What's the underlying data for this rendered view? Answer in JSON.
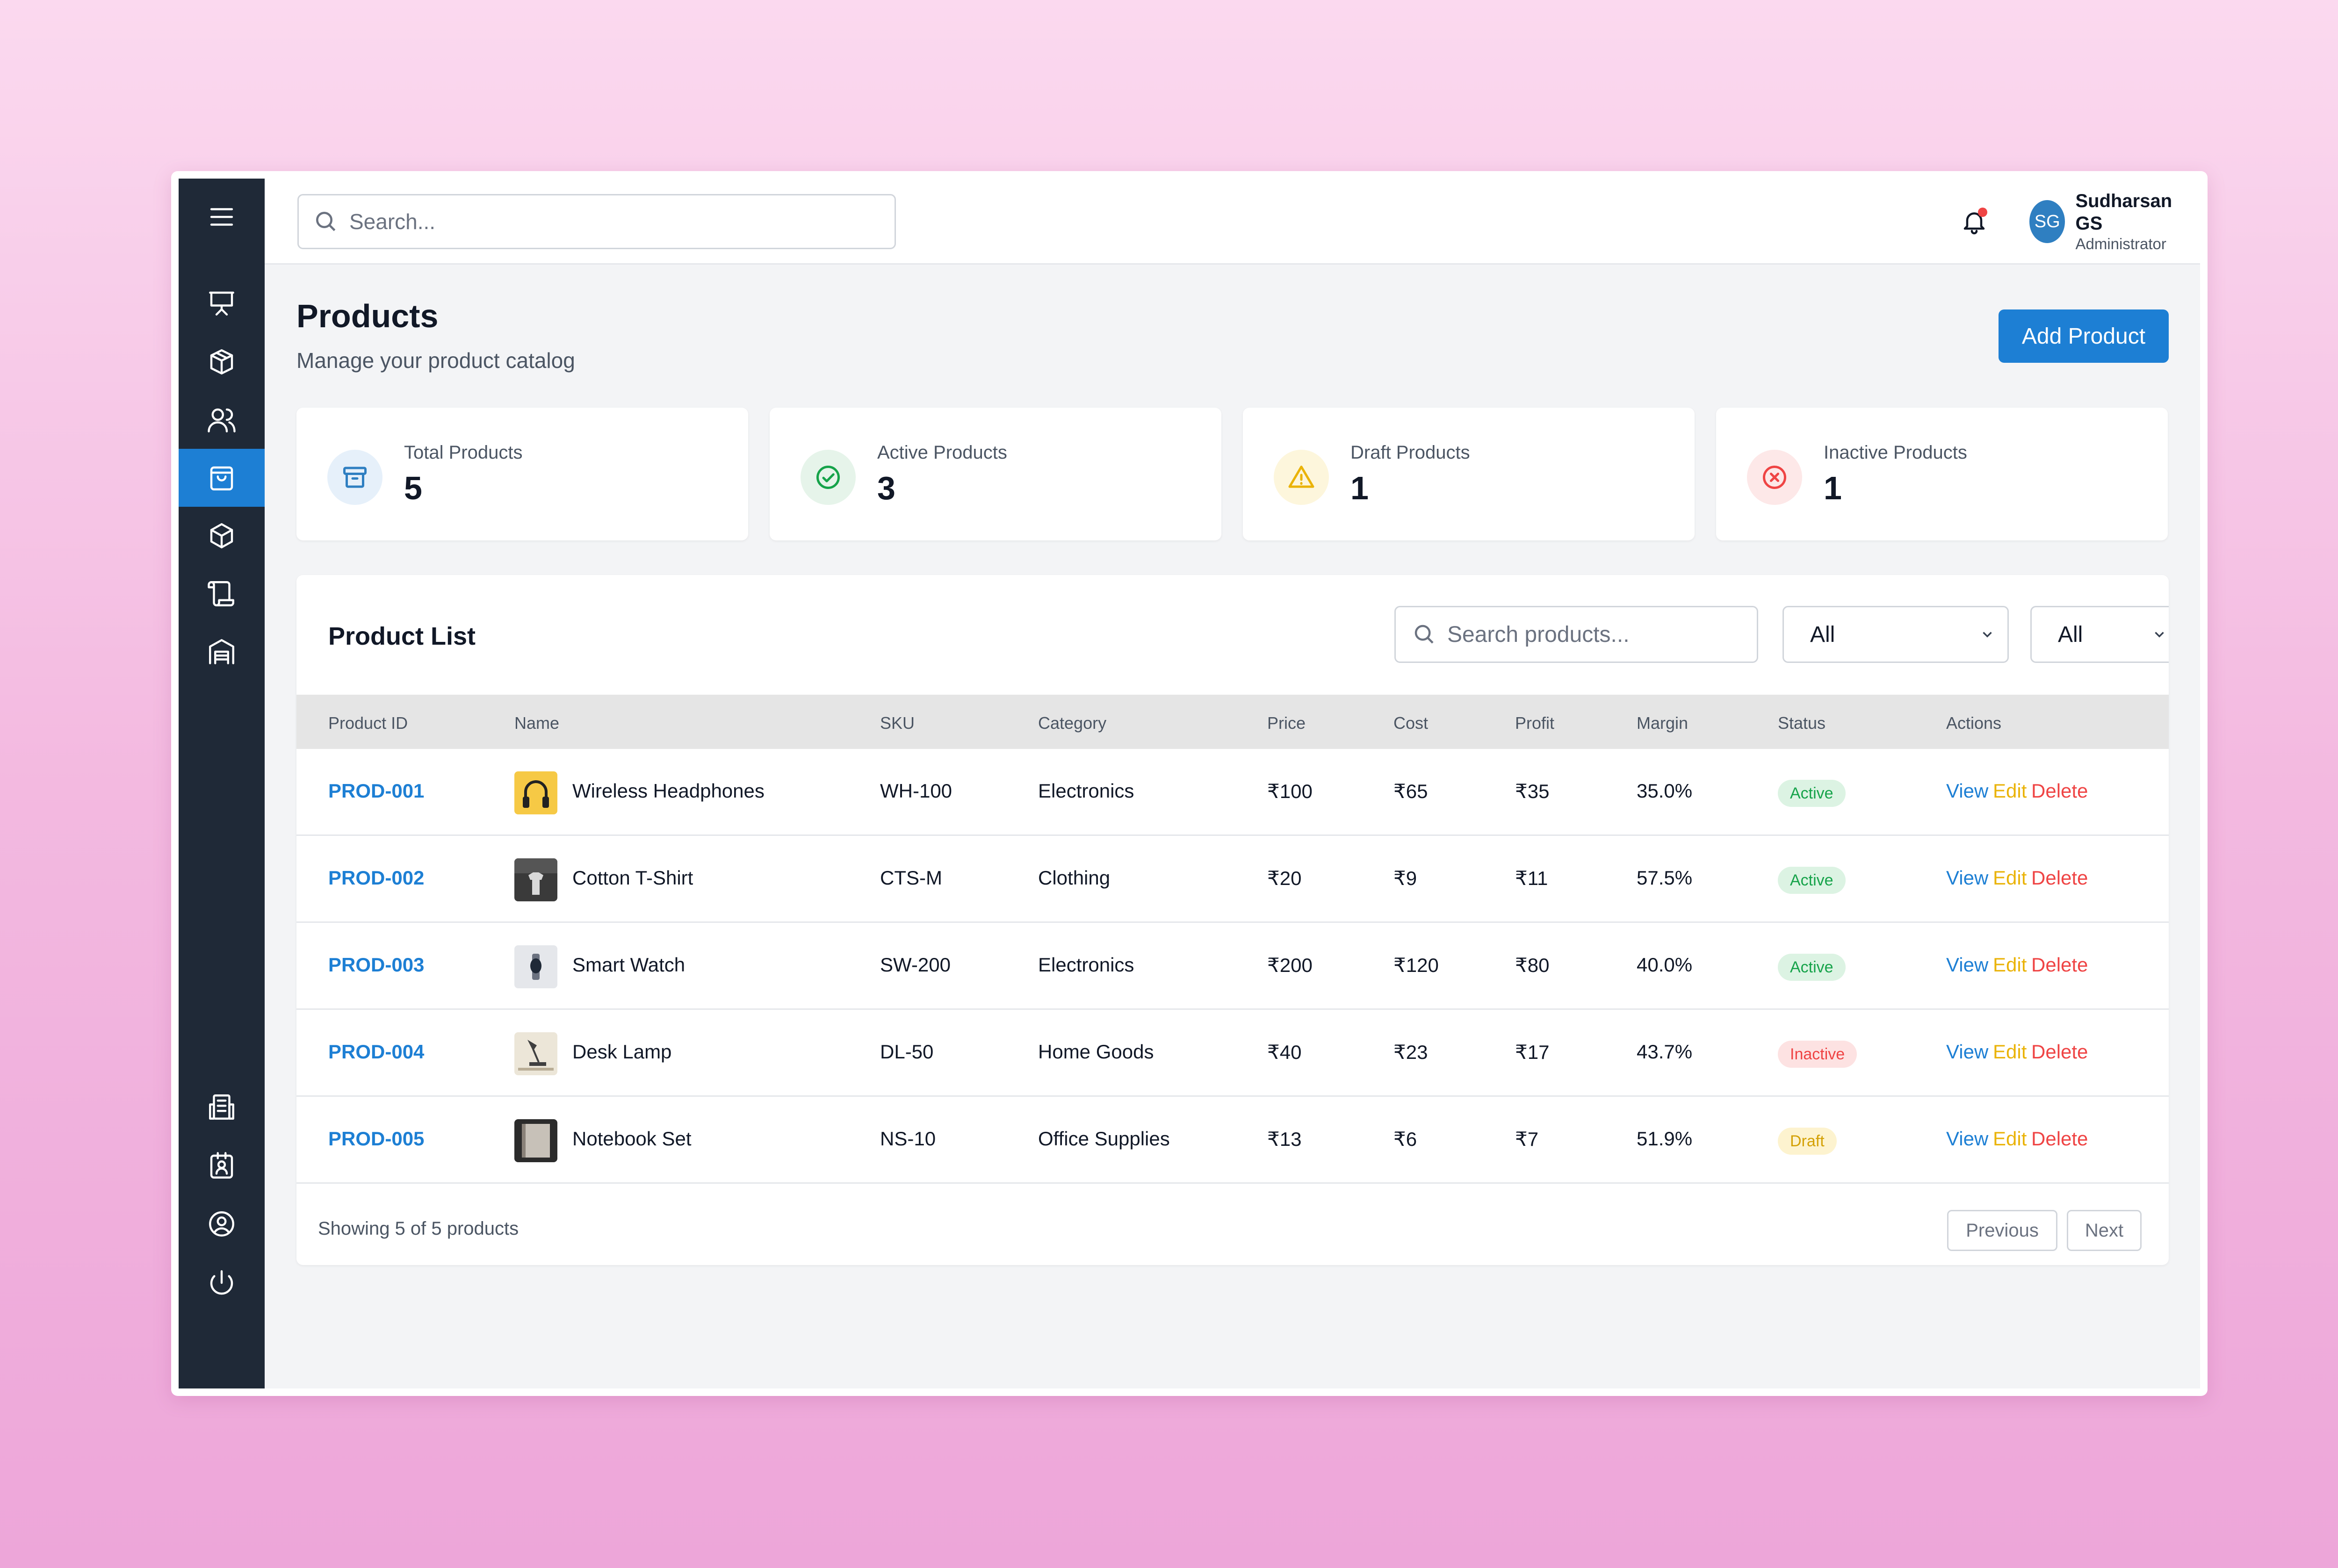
{
  "search": {
    "placeholder": "Search..."
  },
  "user": {
    "initials": "SG",
    "name": "Sudharsan GS",
    "role": "Administrator"
  },
  "page": {
    "title": "Products",
    "subtitle": "Manage your product catalog",
    "add_button": "Add Product"
  },
  "stats": [
    {
      "label": "Total Products",
      "value": "5",
      "icon": "archive-icon",
      "color": "#2f7fc1",
      "bg": "#e6f0fa"
    },
    {
      "label": "Active Products",
      "value": "3",
      "icon": "check-circle-icon",
      "color": "#16a34a",
      "bg": "#e6f4ea"
    },
    {
      "label": "Draft Products",
      "value": "1",
      "icon": "warning-icon",
      "color": "#eab308",
      "bg": "#fdf6dc"
    },
    {
      "label": "Inactive Products",
      "value": "1",
      "icon": "x-circle-icon",
      "color": "#ef4444",
      "bg": "#fde8e8"
    }
  ],
  "product_list": {
    "title": "Product List",
    "search_placeholder": "Search products...",
    "filters": [
      "All",
      "All"
    ],
    "columns": [
      "Product ID",
      "Name",
      "SKU",
      "Category",
      "Price",
      "Cost",
      "Profit",
      "Margin",
      "Status",
      "Actions"
    ],
    "actions": {
      "view": "View",
      "edit": "Edit",
      "delete": "Delete"
    },
    "rows": [
      {
        "id": "PROD-001",
        "name": "Wireless Headphones",
        "sku": "WH-100",
        "category": "Electronics",
        "price": "₹100",
        "cost": "₹65",
        "profit": "₹35",
        "margin": "35.0%",
        "status": "Active",
        "thumb": "headphones-thumbnail"
      },
      {
        "id": "PROD-002",
        "name": "Cotton T-Shirt",
        "sku": "CTS-M",
        "category": "Clothing",
        "price": "₹20",
        "cost": "₹9",
        "profit": "₹11",
        "margin": "57.5%",
        "status": "Active",
        "thumb": "tshirt-thumbnail"
      },
      {
        "id": "PROD-003",
        "name": "Smart Watch",
        "sku": "SW-200",
        "category": "Electronics",
        "price": "₹200",
        "cost": "₹120",
        "profit": "₹80",
        "margin": "40.0%",
        "status": "Active",
        "thumb": "watch-thumbnail"
      },
      {
        "id": "PROD-004",
        "name": "Desk Lamp",
        "sku": "DL-50",
        "category": "Home Goods",
        "price": "₹40",
        "cost": "₹23",
        "profit": "₹17",
        "margin": "43.7%",
        "status": "Inactive",
        "thumb": "lamp-thumbnail"
      },
      {
        "id": "PROD-005",
        "name": "Notebook Set",
        "sku": "NS-10",
        "category": "Office Supplies",
        "price": "₹13",
        "cost": "₹6",
        "profit": "₹7",
        "margin": "51.9%",
        "status": "Draft",
        "thumb": "notebook-thumbnail"
      }
    ],
    "footer": {
      "showing": "Showing 5 of 5 products",
      "previous": "Previous",
      "next": "Next"
    }
  },
  "status_colors": {
    "Active": {
      "text": "#16a34a",
      "bg": "#dcf3e3"
    },
    "Inactive": {
      "text": "#ef4444",
      "bg": "#fde2e2"
    },
    "Draft": {
      "text": "#d4a106",
      "bg": "#fdf3cf"
    }
  },
  "theme": {
    "accent": "#1d7fd4",
    "sidebar": "#1f2937",
    "edit": "#eab308",
    "delete": "#ef4444"
  }
}
